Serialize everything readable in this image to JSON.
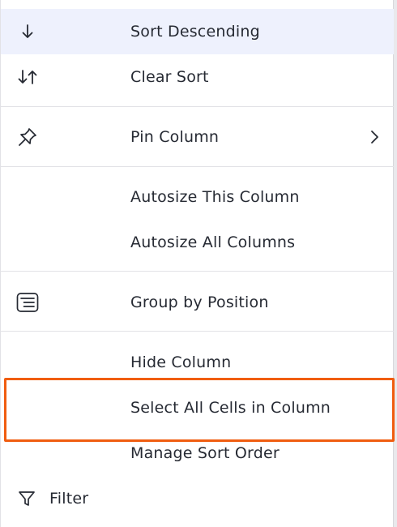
{
  "menu": {
    "items": [
      {
        "label": "Sort Descending",
        "icon": "arrow-down-icon",
        "active": true
      },
      {
        "label": "Clear Sort",
        "icon": "sort-arrows-icon"
      },
      {
        "label": "Pin Column",
        "icon": "pin-icon",
        "submenu": "chevron-right-icon"
      },
      {
        "label": "Autosize This Column"
      },
      {
        "label": "Autosize All Columns"
      },
      {
        "label": "Group by Position",
        "icon": "group-icon"
      },
      {
        "label": "Hide Column"
      },
      {
        "label": "Select All Cells in Column",
        "highlighted": true
      },
      {
        "label": "Manage Sort Order"
      },
      {
        "label": "Filter",
        "icon": "filter-icon"
      }
    ]
  },
  "colors": {
    "active_row": "#eef1fd",
    "highlight_border": "#f05d10",
    "text": "#262a33"
  }
}
